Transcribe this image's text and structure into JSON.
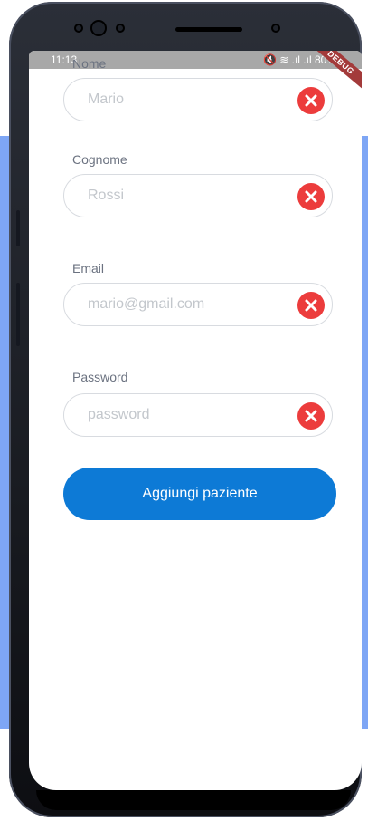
{
  "status_bar": {
    "time": "11:13",
    "right": "🔇 ≋ .ıl .ıl 80%",
    "debug_banner": "DEBUG"
  },
  "form": {
    "fields": [
      {
        "label": "Nome",
        "value": "Mario"
      },
      {
        "label": "Cognome",
        "value": "Rossi"
      },
      {
        "label": "Email",
        "value": "mario@gmail.com"
      },
      {
        "label": "Password",
        "value": "password"
      }
    ],
    "submit_label": "Aggiungi paziente"
  },
  "colors": {
    "accent": "#0d7ad6",
    "clear": "#ec3c3c",
    "backdrop": "#7ea6f5"
  },
  "icons": [
    "close-icon"
  ]
}
